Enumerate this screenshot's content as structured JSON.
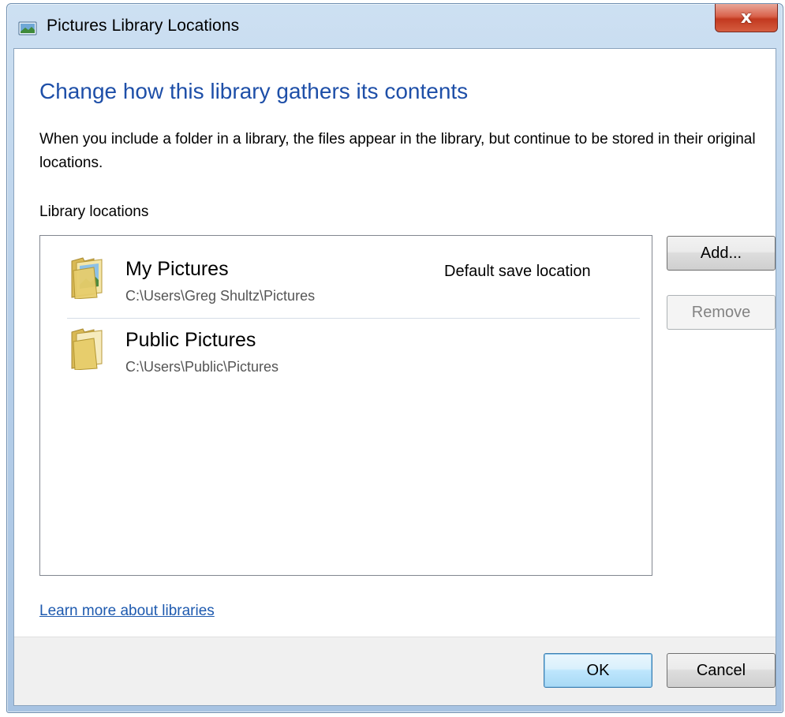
{
  "window": {
    "title": "Pictures Library Locations",
    "close_label": "x"
  },
  "main": {
    "heading": "Change how this library gathers its contents",
    "description": "When you include a folder in a library, the files appear in the library, but continue to be stored in their original locations.",
    "section_label": "Library locations"
  },
  "locations": [
    {
      "name": "My Pictures",
      "path": "C:\\Users\\Greg Shultz\\Pictures",
      "tag": "Default save location",
      "icon": "pictures-folder-icon"
    },
    {
      "name": "Public Pictures",
      "path": "C:\\Users\\Public\\Pictures",
      "tag": "",
      "icon": "folder-icon"
    }
  ],
  "buttons": {
    "add": "Add...",
    "remove": "Remove",
    "ok": "OK",
    "cancel": "Cancel"
  },
  "link": {
    "learn_more": "Learn more about libraries"
  },
  "colors": {
    "heading": "#1e4fa8",
    "link": "#1e5aaf",
    "close_button": "#c2391f"
  }
}
